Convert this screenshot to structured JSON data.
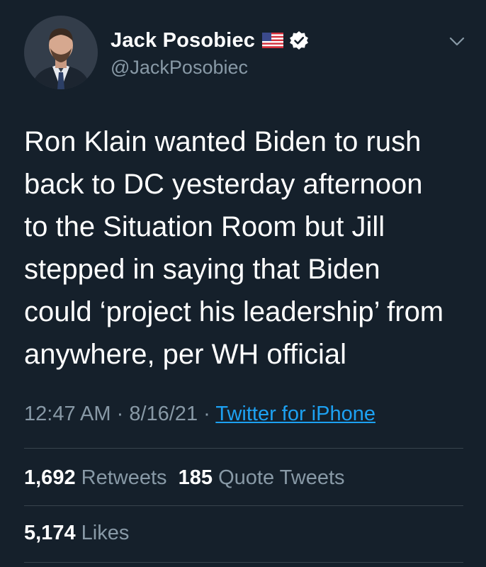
{
  "user": {
    "display_name": "Jack Posobiec",
    "handle": "@JackPosobiec",
    "flag_icon": "us-flag-icon",
    "verified_icon": "verified-badge-icon"
  },
  "tweet": {
    "text": "Ron Klain wanted Biden to rush\nback to DC yesterday afternoon\nto the Situation Room but Jill\nstepped in saying that Biden\ncould ‘project his leadership’ from\nanywhere, per WH official",
    "time": "12:47 AM",
    "sep1": " · ",
    "date": "8/16/21",
    "sep2": " · ",
    "source": "Twitter for iPhone"
  },
  "stats": {
    "retweets_count": "1,692",
    "retweets_label": "Retweets",
    "quotes_count": "185",
    "quotes_label": "Quote Tweets",
    "likes_count": "5,174",
    "likes_label": "Likes"
  },
  "colors": {
    "background": "#15202b",
    "text": "#ffffff",
    "secondary_text": "#8899a6",
    "link": "#1da1f2",
    "divider": "#38444d"
  }
}
